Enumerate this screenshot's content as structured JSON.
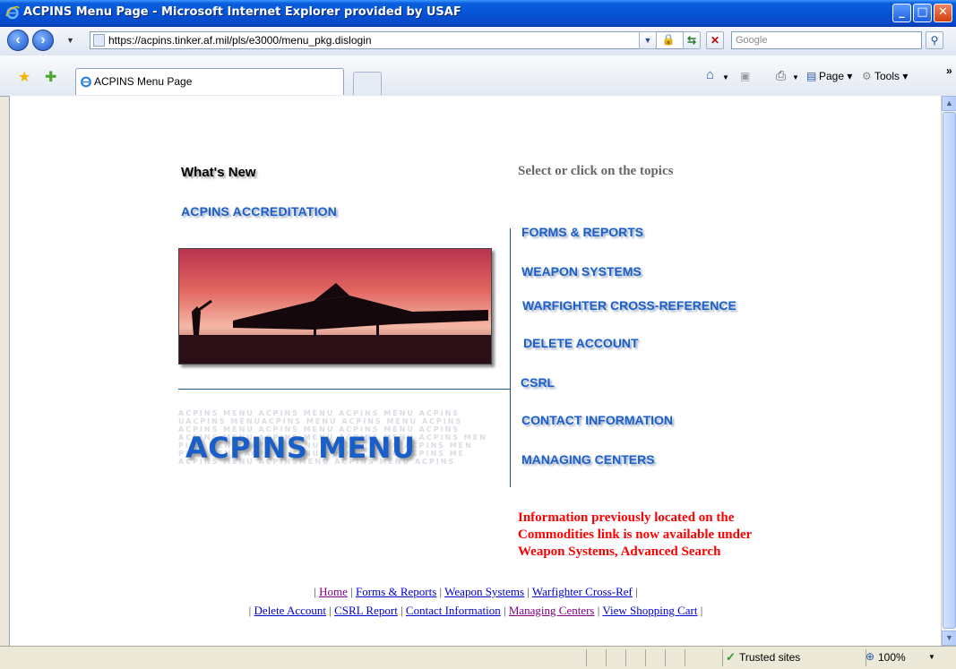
{
  "window": {
    "title": "ACPINS Menu Page - Microsoft Internet Explorer provided by USAF",
    "controls": {
      "minimize": "_",
      "maximize": "□",
      "close": "✕"
    }
  },
  "addressbar": {
    "url": "https://acpins.tinker.af.mil/pls/e3000/menu_pkg.dislogin",
    "search_placeholder": "Google"
  },
  "tabs": [
    {
      "label": "ACPINS Menu Page",
      "active": true
    }
  ],
  "command_bar": {
    "page_label": "Page",
    "tools_label": "Tools",
    "more": "»"
  },
  "page": {
    "whats_new": "What's New",
    "select_topics": "Select or click on the topics",
    "accreditation_link": "ACPINS ACCREDITATION",
    "menu_title": "ACPINS MENU",
    "menu_watermark": [
      "ACPINS MENU ACPINS  MENU ACPINS MENU ACPINS",
      "UACPINS MENUACPINS MENU ACPINS MENU ACPINS",
      " ACPINS MENU ACPINS MENU ACPINS MENU ACPINS",
      "ACPINS MENU ACPINS MENU ACPINS MENU ACPINS MEN",
      "PINS MENU ACPINS MENU ACPINS MENU ACPINS MEN",
      "PINS MENU ACPINS MENU ACPINS MENU ACPINS ME",
      " ACPINS MENU ACPINSMENU ACPINS MENU ACPINS"
    ],
    "topics": [
      "FORMS & REPORTS",
      "WEAPON SYSTEMS",
      "WARFIGHTER CROSS-REFERENCE",
      "DELETE ACCOUNT",
      "CSRL",
      "CONTACT INFORMATION",
      "MANAGING CENTERS"
    ],
    "notice": "Information previously located on the Commodities link is now available under Weapon Systems, Advanced Search",
    "footer_row1": [
      "Home",
      "Forms & Reports",
      "Weapon Systems",
      "Warfighter Cross-Ref"
    ],
    "footer_row2": [
      "Delete Account",
      "CSRL Report",
      "Contact Information",
      "Managing Centers",
      "View Shopping Cart"
    ]
  },
  "statusbar": {
    "zone": "Trusted sites",
    "zoom": "100%"
  },
  "colors": {
    "topic_blue": "#1a5fc7",
    "notice_red": "#ff0000",
    "titlebar_blue": "#0553d6"
  }
}
